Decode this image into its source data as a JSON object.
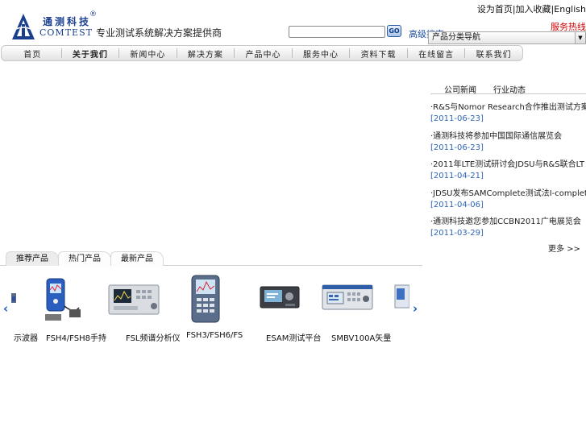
{
  "header": {
    "logo_cn": "通测科技",
    "logo_reg": "®",
    "logo_en": "COMTEST",
    "slogan": "专业测试系统解决方案提供商",
    "top_link_1": "设为首页",
    "top_sep_1": "|",
    "top_link_2": "加入收藏",
    "top_sep_2": "|",
    "top_link_3": "English",
    "hotline": "服务热线",
    "search_placeholder": "",
    "go_label": "GO",
    "advanced_search": "高级搜索",
    "select_value": "产品分类导航"
  },
  "nav": {
    "items": [
      "首页",
      "关于我们",
      "新闻中心",
      "解决方案",
      "产品中心",
      "服务中心",
      "资料下载",
      "在线留言",
      "联系我们"
    ],
    "active_index": 1
  },
  "news": {
    "tab_1": "公司新闻",
    "tab_2": "行业动态",
    "items": [
      {
        "title": "·R&S与Nomor Research合作推出测试方案",
        "date": "[2011-06-23]"
      },
      {
        "title": "·通测科技将参加中国国际通信展览会",
        "date": "[2011-06-23]"
      },
      {
        "title": "·2011年LTE测试研讨会JDSU与R&S联合LT",
        "date": "[2011-04-21]"
      },
      {
        "title": "·JDSU发布SAMComplete测试法I-complete解",
        "date": "[2011-04-06]"
      },
      {
        "title": "·通测科技邀您参加CCBN2011广电展览会",
        "date": "[2011-03-29]"
      }
    ],
    "more": "更多 >>"
  },
  "products": {
    "tabs": [
      "推荐产品",
      "热门产品",
      "最新产品"
    ],
    "active_tab": 0,
    "left_arrow": "‹",
    "right_arrow": "›",
    "labels": [
      "示波器",
      "FSH4/FSH8手持",
      "FSL频谱分析仪",
      "FSH3/FSH6/FS",
      "ESAM测试平台",
      "SMBV100A矢量"
    ]
  },
  "colors": {
    "brand_blue": "#1b3f8f",
    "link_blue": "#2d64b8",
    "hotline_red": "#d00000"
  }
}
